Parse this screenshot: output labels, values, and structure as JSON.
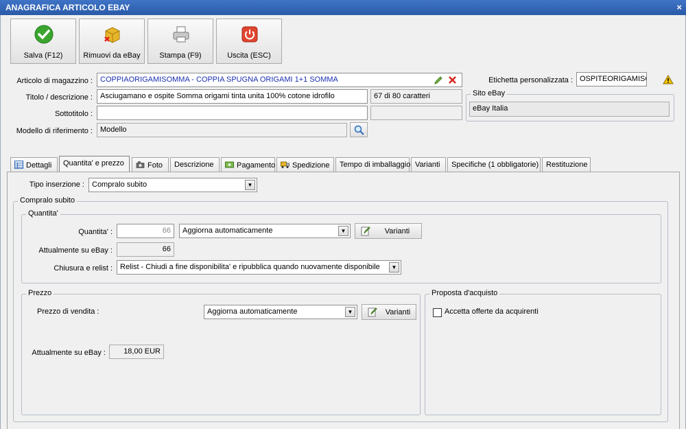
{
  "window": {
    "title": "ANAGRAFICA ARTICOLO EBAY",
    "close": "×"
  },
  "toolbar": {
    "save": "Salva (F12)",
    "remove": "Rimuovi da eBay",
    "print": "Stampa (F9)",
    "exit": "Uscita (ESC)"
  },
  "header": {
    "article_label": "Articolo di magazzino :",
    "article_value": "COPPIAORIGAMISOMMA  -  COPPIA SPUGNA ORIGAMI 1+1 SOMMA",
    "title_label": "Titolo / descrizione :",
    "title_value": "Asciugamano e ospite Somma origami tinta unita 100% cotone idrofilo",
    "title_counter": "67 di 80 caratteri",
    "subtitle_label": "Sottotitolo :",
    "subtitle_value": "",
    "model_label": "Modello di riferimento :",
    "model_value": "Modello",
    "custom_label_label": "Etichetta personalizzata :",
    "custom_label_value": "OSPITEORIGAMISOMMA",
    "site_group": "Sito eBay",
    "site_value": "eBay Italia"
  },
  "tabs": [
    {
      "label": "Dettagli",
      "icon": "table-icon"
    },
    {
      "label": "Quantita' e prezzo",
      "icon": ""
    },
    {
      "label": "Foto",
      "icon": "camera-icon"
    },
    {
      "label": "Descrizione",
      "icon": ""
    },
    {
      "label": "Pagamento",
      "icon": "money-icon"
    },
    {
      "label": "Spedizione",
      "icon": "truck-icon"
    },
    {
      "label": "Tempo di imballaggio",
      "icon": ""
    },
    {
      "label": "Varianti",
      "icon": ""
    },
    {
      "label": "Specifiche (1 obbligatorie)",
      "icon": ""
    },
    {
      "label": "Restituzione",
      "icon": ""
    }
  ],
  "active_tab": 1,
  "qp": {
    "insertion_type_label": "Tipo inserzione :",
    "insertion_type_value": "Compralo subito",
    "buy_now_group": "Compralo subito",
    "quantity_group": "Quantita'",
    "quantity_label": "Quantita' :",
    "quantity_value": "66",
    "quantity_mode": "Aggiorna automaticamente",
    "variants_button": "Varianti",
    "current_ebay_label": "Attualmente su eBay :",
    "current_ebay_qty": "66",
    "close_relist_label": "Chiusura e relist :",
    "close_relist_value": "Relist - Chiudi a fine disponibilita' e ripubblica quando nuovamente disponibile",
    "price_group": "Prezzo",
    "sale_price_label": "Prezzo di vendita :",
    "price_mode": "Aggiorna automaticamente",
    "price_variants_button": "Varianti",
    "price_current_label": "Attualmente su eBay :",
    "price_current_value": "18,00 EUR",
    "offer_group": "Proposta d'acquisto",
    "accept_offers_label": "Accetta offerte da acquirenti"
  },
  "colors": {
    "titlebar": "#2d5dab",
    "link_blue": "#1a2fb0",
    "warning": "#f2c200"
  }
}
